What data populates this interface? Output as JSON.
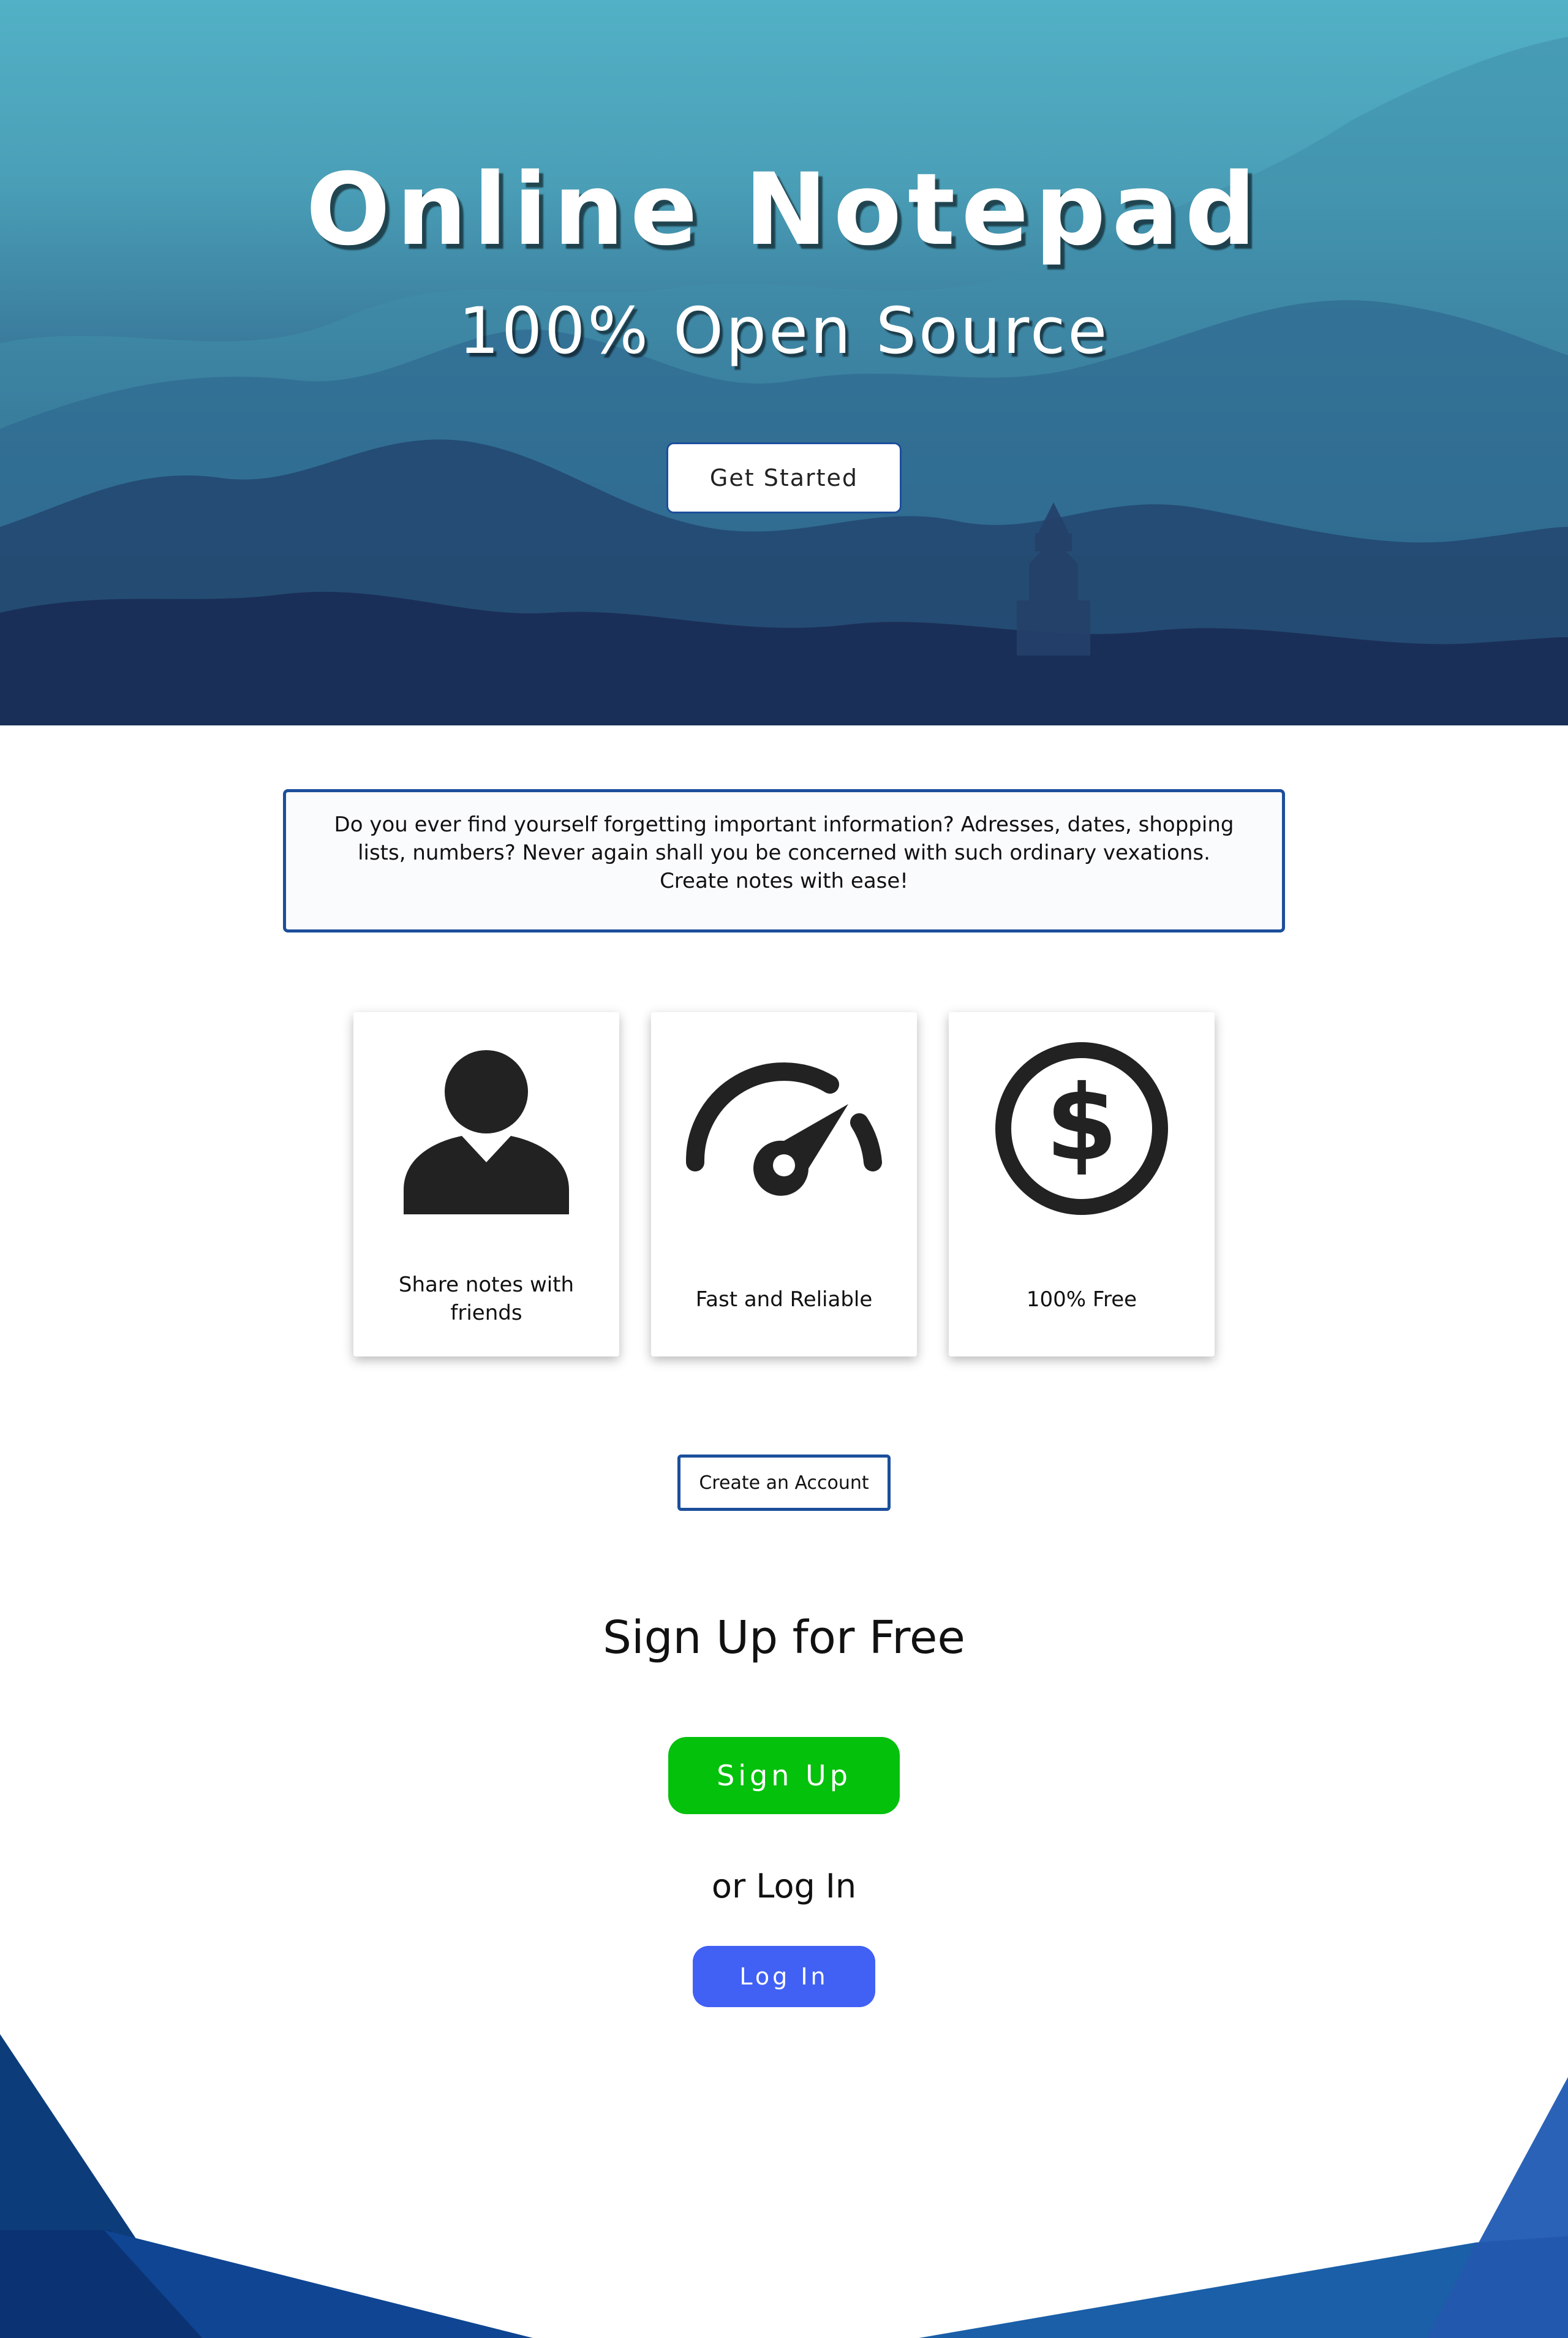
{
  "hero": {
    "title": "Online Notepad",
    "subtitle": "100% Open Source",
    "cta_label": "Get Started"
  },
  "intro": {
    "text": "Do you ever find yourself forgetting important information? Adresses, dates, shopping lists, numbers? Never again shall you be concerned with such ordinary vexations. Create notes with ease!"
  },
  "features": [
    {
      "icon": "user-icon",
      "label": "Share notes with friends"
    },
    {
      "icon": "speedometer-icon",
      "label": "Fast and Reliable"
    },
    {
      "icon": "dollar-circle-icon",
      "label": "100% Free"
    }
  ],
  "create_account": {
    "label": "Create an Account"
  },
  "signup": {
    "heading": "Sign Up for Free",
    "button_label": "Sign Up",
    "or_login_text": "or Log In",
    "login_label": "Log In"
  },
  "colors": {
    "accent_border": "#1c4f9c",
    "signup_green": "#04c10b",
    "login_blue": "#4161f4",
    "icon_dark": "#222222"
  }
}
